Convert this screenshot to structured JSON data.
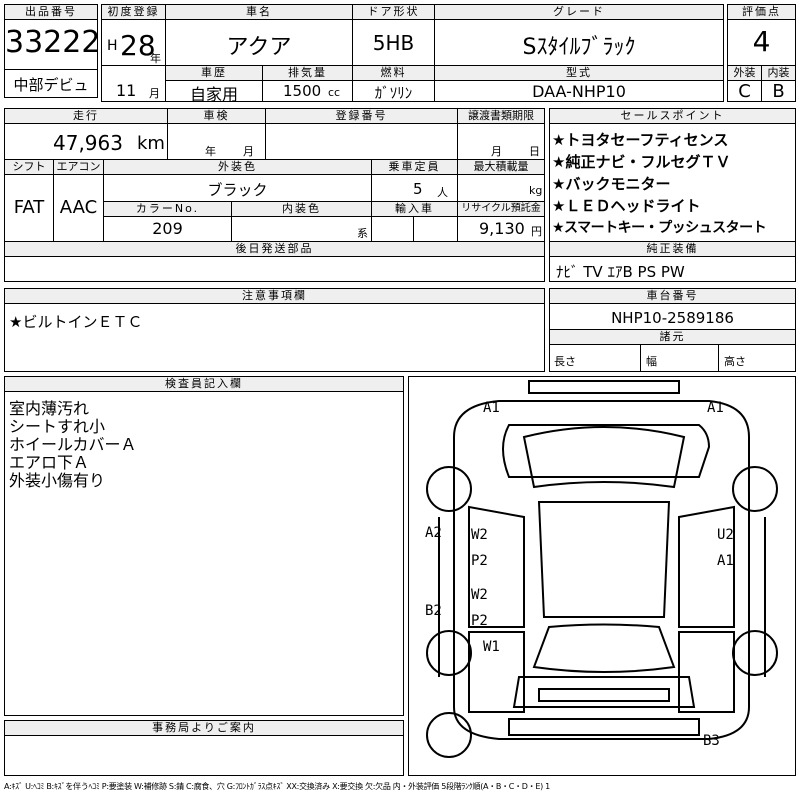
{
  "lot": {
    "label": "出品番号",
    "number": "33222",
    "section": "中部デビュ"
  },
  "first_reg": {
    "label": "初度登録",
    "era": "H",
    "year": "28",
    "year_unit": "年",
    "month": "11",
    "month_unit": "月"
  },
  "car_name": {
    "label": "車名",
    "value": "アクア"
  },
  "door": {
    "label": "ドア形状",
    "value": "5HB"
  },
  "grade": {
    "label": "グレード",
    "value": "Sｽﾀｲﾙﾌﾞﾗｯｸ"
  },
  "score": {
    "label": "評価点",
    "value": "4",
    "ext_label": "外装",
    "int_label": "内装",
    "ext_value": "C",
    "int_value": "B"
  },
  "history": {
    "label": "車歴",
    "value": "自家用"
  },
  "displacement": {
    "label": "排気量",
    "value": "1500",
    "unit": "cc"
  },
  "fuel": {
    "label": "燃料",
    "value": "ｶﾞｿﾘﾝ"
  },
  "model": {
    "label": "型式",
    "value": "DAA-NHP10"
  },
  "mileage": {
    "label": "走行",
    "value": "47,963",
    "unit": "km"
  },
  "inspection": {
    "label": "車検",
    "year_unit": "年",
    "month_unit": "月"
  },
  "reg_no": {
    "label": "登録番号"
  },
  "transfer": {
    "label": "譲渡書類期限",
    "month_unit": "月",
    "day_unit": "日"
  },
  "shift": {
    "label": "シフト",
    "value": "FAT"
  },
  "aircon": {
    "label": "エアコン",
    "value": "AAC"
  },
  "ext_color": {
    "label": "外装色",
    "value": "ブラック"
  },
  "capacity": {
    "label": "乗車定員",
    "value": "5",
    "unit": "人"
  },
  "max_load": {
    "label": "最大積載量",
    "unit": "kg"
  },
  "color_no": {
    "label": "カラーNo.",
    "value": "209"
  },
  "int_color": {
    "label": "内装色",
    "unit": "系"
  },
  "import": {
    "label": "輸入車"
  },
  "recycle": {
    "label": "リサイクル預託金",
    "value": "9,130",
    "unit": "円"
  },
  "later_parts": {
    "label": "後日発送部品"
  },
  "sale_points": {
    "label": "セールスポイント",
    "items": [
      "★トヨタセーフティセンス",
      "★純正ナビ・フルセグＴＶ",
      "★バックモニター",
      "★ＬＥＤヘッドライト",
      "★スマートキー・プッシュスタート"
    ]
  },
  "equipment": {
    "label": "純正装備",
    "value": "ﾅﾋﾞ TV ｴｱB PS PW"
  },
  "notes": {
    "label": "注意事項欄",
    "value": "★ビルトインＥＴＣ"
  },
  "chassis": {
    "label": "車台番号",
    "value": "NHP10-2589186"
  },
  "dimensions": {
    "label": "諸元",
    "length": "長さ",
    "width": "幅",
    "height": "高さ"
  },
  "inspector": {
    "label": "検査員記入欄",
    "lines": [
      "室内薄汚れ",
      "シートすれ小",
      "ホイールカバーＡ",
      "エアロ下Ａ",
      "外装小傷有り"
    ]
  },
  "office": {
    "label": "事務局よりご案内"
  },
  "damage_map": {
    "marks": [
      "A1",
      "A1",
      "A2",
      "B2",
      "W2",
      "P2",
      "W2",
      "P2",
      "W1",
      "U2",
      "A1",
      "B3"
    ]
  },
  "legend": "A:ｷｽﾞ U:ﾍｺﾐ B:ｷｽﾞを伴うﾍｺﾐ P:要塗装 W:補修跡 S:錆 C:腐食、穴 G:ﾌﾛﾝﾄｶﾞﾗｽ点ｷｽﾞ XX:交換済み X:要交換 欠:欠品 内・外装評価 5段階ﾗﾝｸ順(A・B・C・D・E) 1"
}
